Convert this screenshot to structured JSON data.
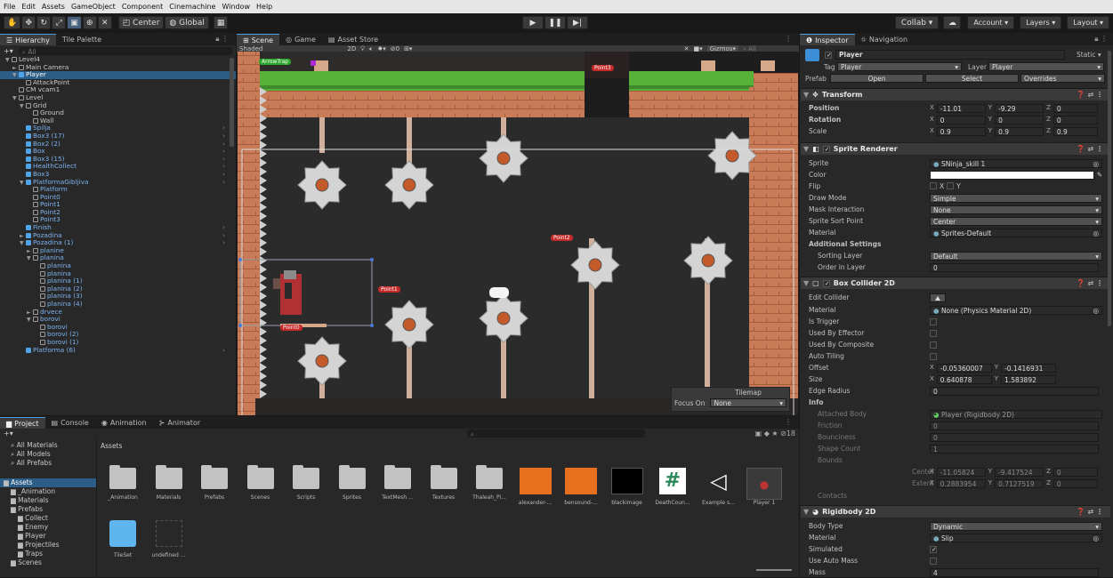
{
  "menu": [
    "File",
    "Edit",
    "Assets",
    "GameObject",
    "Component",
    "Cinemachine",
    "Window",
    "Help"
  ],
  "toolbar": {
    "pivot": "Center",
    "space": "Global",
    "collab": "Collab ▾",
    "account": "Account",
    "layers": "Layers",
    "layout": "Layout"
  },
  "hierarchy": {
    "tab1": "Hierarchy",
    "tab2": "Tile Palette",
    "search": "All",
    "items": [
      {
        "label": "Level4",
        "indent": 0,
        "icon": "unity",
        "arrow": "▼"
      },
      {
        "label": "Main Camera",
        "indent": 1,
        "icon": "out",
        "arrow": "►"
      },
      {
        "label": "Player",
        "indent": 1,
        "icon": "blue",
        "arrow": "▼",
        "sel": true
      },
      {
        "label": "AttackPoint",
        "indent": 2,
        "icon": "out"
      },
      {
        "label": "CM vcam1",
        "indent": 1,
        "icon": "out"
      },
      {
        "label": "Level",
        "indent": 1,
        "icon": "out",
        "arrow": "▼"
      },
      {
        "label": "Grid",
        "indent": 2,
        "icon": "out",
        "arrow": "▼"
      },
      {
        "label": "Ground",
        "indent": 3,
        "icon": "out"
      },
      {
        "label": "Wall",
        "indent": 3,
        "icon": "out"
      },
      {
        "label": "Spilja",
        "indent": 2,
        "icon": "blue",
        "blue": true,
        "more": true
      },
      {
        "label": "Box3 (17)",
        "indent": 2,
        "icon": "blue",
        "blue": true,
        "more": true
      },
      {
        "label": "Box2 (2)",
        "indent": 2,
        "icon": "blue",
        "blue": true,
        "more": true
      },
      {
        "label": "Box",
        "indent": 2,
        "icon": "blue",
        "blue": true,
        "more": true
      },
      {
        "label": "Box3 (15)",
        "indent": 2,
        "icon": "blue",
        "blue": true,
        "more": true
      },
      {
        "label": "HealthCollect",
        "indent": 2,
        "icon": "blue",
        "blue": true,
        "more": true
      },
      {
        "label": "Box3",
        "indent": 2,
        "icon": "blue",
        "blue": true,
        "more": true
      },
      {
        "label": "PlatformaGibljiva",
        "indent": 2,
        "icon": "blue",
        "blue": true,
        "arrow": "▼",
        "more": true
      },
      {
        "label": "Platform",
        "indent": 3,
        "icon": "out",
        "blue": true
      },
      {
        "label": "Point0",
        "indent": 3,
        "icon": "out",
        "blue": true
      },
      {
        "label": "Point1",
        "indent": 3,
        "icon": "out",
        "blue": true
      },
      {
        "label": "Point2",
        "indent": 3,
        "icon": "out",
        "blue": true
      },
      {
        "label": "Point3",
        "indent": 3,
        "icon": "out",
        "blue": true
      },
      {
        "label": "Finish",
        "indent": 2,
        "icon": "blue",
        "blue": true,
        "more": true
      },
      {
        "label": "Pozadina",
        "indent": 2,
        "icon": "blue",
        "blue": true,
        "arrow": "►",
        "more": true
      },
      {
        "label": "Pozadina (1)",
        "indent": 2,
        "icon": "blue",
        "blue": true,
        "arrow": "▼",
        "more": true
      },
      {
        "label": "planine",
        "indent": 3,
        "icon": "out",
        "blue": true,
        "arrow": "►"
      },
      {
        "label": "planina",
        "indent": 3,
        "icon": "out",
        "blue": true,
        "arrow": "▼"
      },
      {
        "label": "planina",
        "indent": 4,
        "icon": "out",
        "blue": true
      },
      {
        "label": "planina",
        "indent": 4,
        "icon": "out",
        "blue": true
      },
      {
        "label": "planina (1)",
        "indent": 4,
        "icon": "out",
        "blue": true
      },
      {
        "label": "planina (2)",
        "indent": 4,
        "icon": "out",
        "blue": true
      },
      {
        "label": "planina (3)",
        "indent": 4,
        "icon": "out",
        "blue": true
      },
      {
        "label": "planina (4)",
        "indent": 4,
        "icon": "out",
        "blue": true
      },
      {
        "label": "drvece",
        "indent": 3,
        "icon": "out",
        "blue": true,
        "arrow": "►"
      },
      {
        "label": "borovi",
        "indent": 3,
        "icon": "out",
        "blue": true,
        "arrow": "▼"
      },
      {
        "label": "borovi",
        "indent": 4,
        "icon": "out",
        "blue": true
      },
      {
        "label": "borovi (2)",
        "indent": 4,
        "icon": "out",
        "blue": true
      },
      {
        "label": "borovi (1)",
        "indent": 4,
        "icon": "out",
        "blue": true
      },
      {
        "label": "Platforma (6)",
        "indent": 2,
        "icon": "blue",
        "blue": true,
        "more": true
      }
    ]
  },
  "scene": {
    "tab_scene": "Scene",
    "tab_game": "Game",
    "tab_store": "Asset Store",
    "shading": "Shaded",
    "mode2d": "2D",
    "gizmos": "Gizmos",
    "search": "All",
    "fx_count": "0",
    "labels": {
      "arrow_trap": "ArrowTrap",
      "point3": "Point3",
      "point2": "Point2",
      "point1": "Point1",
      "point0": "Point0"
    },
    "tilemap": {
      "title": "Tilemap",
      "focus_label": "Focus On",
      "focus_value": "None"
    }
  },
  "inspector": {
    "tab1": "Inspector",
    "tab2": "Navigation",
    "object_name": "Player",
    "static": "Static",
    "tag_label": "Tag",
    "tag": "Player",
    "layer_label": "Layer",
    "layer": "Player",
    "prefab_label": "Prefab",
    "prefab_open": "Open",
    "prefab_select": "Select",
    "prefab_overrides": "Overrides",
    "transform": {
      "title": "Transform",
      "position_label": "Position",
      "position": {
        "x": "-11.01",
        "y": "-9.29",
        "z": "0"
      },
      "rotation_label": "Rotation",
      "rotation": {
        "x": "0",
        "y": "0",
        "z": "0"
      },
      "scale_label": "Scale",
      "scale": {
        "x": "0.9",
        "y": "0.9",
        "z": "0.9"
      }
    },
    "sprite_renderer": {
      "title": "Sprite Renderer",
      "sprite_label": "Sprite",
      "sprite": "SNinja_skill 1",
      "color_label": "Color",
      "flip_label": "Flip",
      "flip_x": "X",
      "flip_y": "Y",
      "draw_mode_label": "Draw Mode",
      "draw_mode": "Simple",
      "mask_label": "Mask Interaction",
      "mask": "None",
      "sort_point_label": "Sprite Sort Point",
      "sort_point": "Center",
      "material_label": "Material",
      "material": "Sprites-Default",
      "additional": "Additional Settings",
      "sorting_layer_label": "Sorting Layer",
      "sorting_layer": "Default",
      "order_label": "Order in Layer",
      "order": "0"
    },
    "box_collider": {
      "title": "Box Collider 2D",
      "edit_label": "Edit Collider",
      "material_label": "Material",
      "material": "None (Physics Material 2D)",
      "trigger_label": "Is Trigger",
      "effector_label": "Used By Effector",
      "composite_label": "Used By Composite",
      "tiling_label": "Auto Tiling",
      "offset_label": "Offset",
      "offset": {
        "x": "-0.05360007",
        "y": "-0.1416931"
      },
      "size_label": "Size",
      "size": {
        "x": "0.640878",
        "y": "1.583892"
      },
      "edge_label": "Edge Radius",
      "edge": "0",
      "info": "Info",
      "attached_label": "Attached Body",
      "attached": "Player (Rigidbody 2D)",
      "friction_label": "Friction",
      "friction": "0",
      "bounciness_label": "Bounciness",
      "bounciness": "0",
      "shape_label": "Shape Count",
      "shape": "1",
      "bounds_label": "Bounds",
      "center_label": "Center",
      "center": {
        "x": "-11.05824",
        "y": "-9.417524",
        "z": "0"
      },
      "extent_label": "Extent",
      "extent": {
        "x": "0.2883954",
        "y": "0.7127519",
        "z": "0"
      },
      "contacts": "Contacts"
    },
    "rigidbody": {
      "title": "Rigidbody 2D",
      "body_type_label": "Body Type",
      "body_type": "Dynamic",
      "material_label": "Material",
      "material": "Slip",
      "simulated_label": "Simulated",
      "auto_mass_label": "Use Auto Mass",
      "mass_label": "Mass",
      "mass": "4"
    }
  },
  "project": {
    "tab1": "Project",
    "tab2": "Console",
    "tab3": "Animation",
    "tab4": "Animator",
    "favorites": [
      "All Materials",
      "All Models",
      "All Prefabs"
    ],
    "tree": [
      {
        "label": "Assets",
        "indent": 0,
        "sel": true
      },
      {
        "label": "_Animation",
        "indent": 1
      },
      {
        "label": "Materials",
        "indent": 1
      },
      {
        "label": "Prefabs",
        "indent": 1
      },
      {
        "label": "Collect",
        "indent": 2
      },
      {
        "label": "Enemy",
        "indent": 2
      },
      {
        "label": "Player",
        "indent": 2
      },
      {
        "label": "Projectiles",
        "indent": 2
      },
      {
        "label": "Traps",
        "indent": 2
      },
      {
        "label": "Scenes",
        "indent": 1
      }
    ],
    "breadcrumb": "Assets",
    "count": "18",
    "assets_row1": [
      {
        "label": "_Animation",
        "kind": "folder"
      },
      {
        "label": "Materials",
        "kind": "folder"
      },
      {
        "label": "Prefabs",
        "kind": "folder"
      },
      {
        "label": "Scenes",
        "kind": "folder"
      },
      {
        "label": "Scripts",
        "kind": "folder"
      },
      {
        "label": "Sprites",
        "kind": "folder"
      },
      {
        "label": "TextMesh ...",
        "kind": "folder"
      },
      {
        "label": "Textures",
        "kind": "folder"
      },
      {
        "label": "Thaleah_Pi...",
        "kind": "folder"
      },
      {
        "label": "alexander-...",
        "kind": "audio"
      },
      {
        "label": "bensound-...",
        "kind": "audio"
      },
      {
        "label": "blackimage",
        "kind": "black"
      },
      {
        "label": "DeathCoun...",
        "kind": "script"
      },
      {
        "label": "Example s...",
        "kind": "unity"
      },
      {
        "label": "Player 1",
        "kind": "player"
      }
    ],
    "assets_row2": [
      {
        "label": "TileSet",
        "kind": "tileset"
      },
      {
        "label": "undefined ...",
        "kind": "undefined"
      }
    ]
  }
}
